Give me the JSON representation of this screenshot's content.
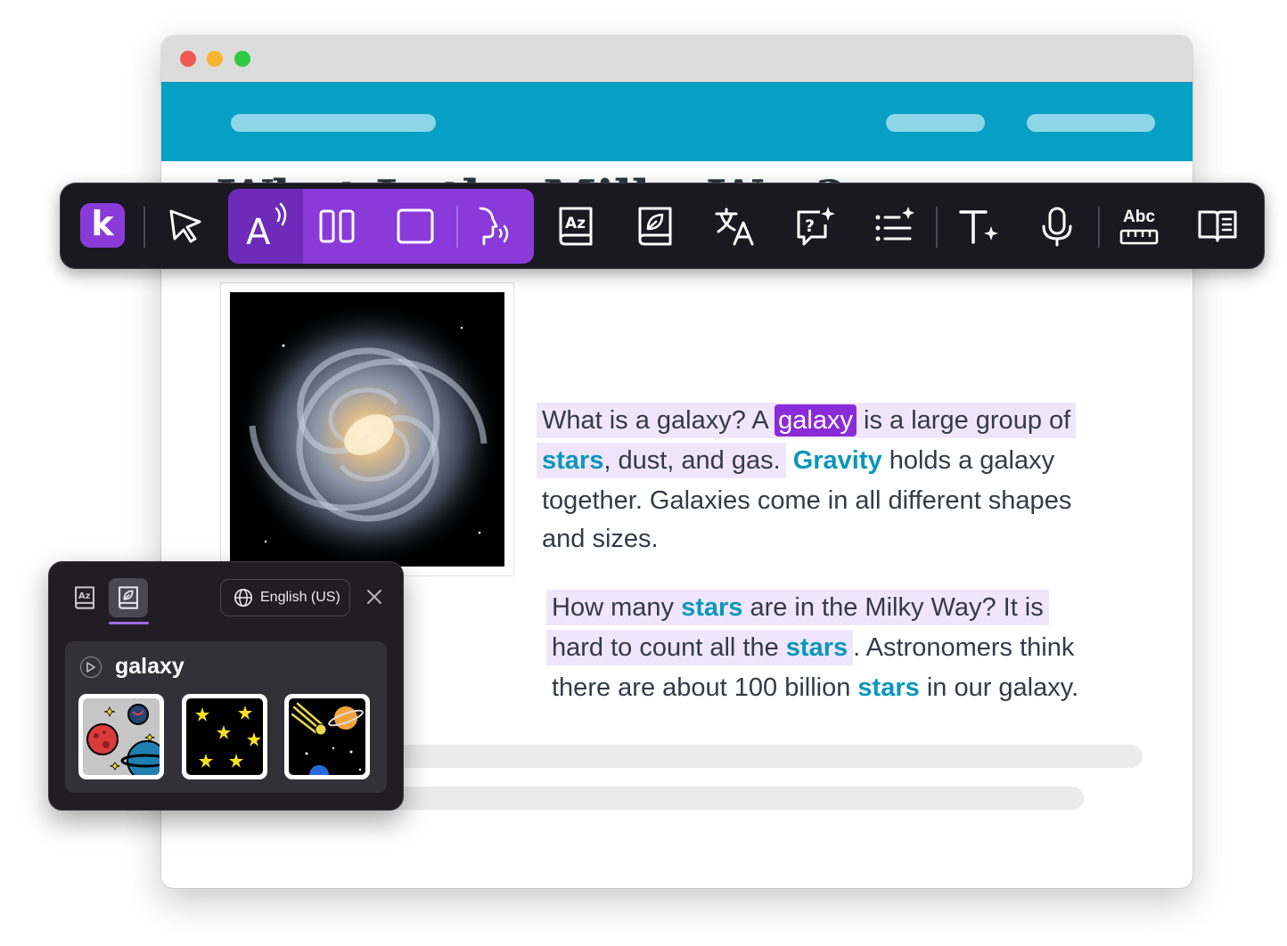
{
  "article": {
    "title": "What Is the Milky Way?",
    "p1": {
      "s1": "What is a galaxy? A",
      "selected_word": "galaxy",
      "s2": "is a large group of",
      "kw_stars": "stars",
      "s3": ", dust, and gas.",
      "kw_gravity": "Gravity",
      "s4": "holds a galaxy",
      "s5": "together. Galaxies come in all different shapes",
      "s6": "and sizes."
    },
    "p2": {
      "s1": "How many",
      "kw1": "stars",
      "s2": "are in the Milky Way? It is",
      "s3": "hard to count all the",
      "kw2": "stars",
      "s4": ". Astronomers think",
      "s5": "there are about 100 billion",
      "kw3": "stars",
      "s6": "in our galaxy."
    }
  },
  "toolbar": {
    "logo_letter": "k",
    "spellcheck_label": "Abc",
    "tools": [
      "logo",
      "select-pointer",
      "read-aloud",
      "columns-view",
      "screen-mask",
      "voice-speech",
      "dictionary",
      "picture-dictionary",
      "translate",
      "ask-question",
      "ai-summary",
      "text-style",
      "microphone",
      "spell-check",
      "reader-mode"
    ]
  },
  "popup": {
    "language": "English (US)",
    "word": "galaxy",
    "images": [
      "planets",
      "stars",
      "comet-and-planet"
    ]
  },
  "colors": {
    "accent": "#8a3ad9",
    "header": "#07a0c5",
    "keyword": "#0a96bc",
    "highlight": "#f0e6fc"
  }
}
